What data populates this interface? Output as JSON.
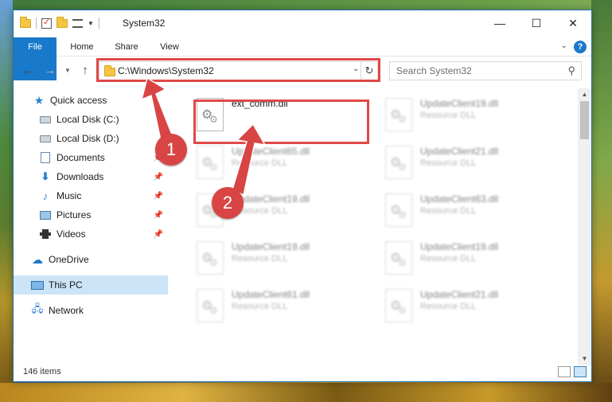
{
  "window": {
    "title": "System32"
  },
  "ribbon": {
    "tabs": [
      "File",
      "Home",
      "Share",
      "View"
    ]
  },
  "address": {
    "path": "C:\\Windows\\System32"
  },
  "search": {
    "placeholder": "Search System32"
  },
  "nav": {
    "items": [
      {
        "label": "Quick access",
        "icon": "star-icon"
      },
      {
        "label": "Local Disk (C:)",
        "icon": "drive-icon"
      },
      {
        "label": "Local Disk (D:)",
        "icon": "drive-icon"
      },
      {
        "label": "Documents",
        "icon": "documents-icon",
        "pinned": true
      },
      {
        "label": "Downloads",
        "icon": "downloads-icon",
        "pinned": true
      },
      {
        "label": "Music",
        "icon": "music-icon",
        "pinned": true
      },
      {
        "label": "Pictures",
        "icon": "pictures-icon",
        "pinned": true
      },
      {
        "label": "Videos",
        "icon": "videos-icon",
        "pinned": true
      },
      {
        "label": "OneDrive",
        "icon": "cloud-icon"
      },
      {
        "label": "This PC",
        "icon": "computer-icon",
        "selected": true
      },
      {
        "label": "Network",
        "icon": "network-icon"
      }
    ]
  },
  "files": [
    {
      "name": "ext_comm.dll",
      "type": ""
    },
    {
      "name": "UpdateClient19.dll",
      "type": "Resource DLL"
    },
    {
      "name": "UpdateClient65.dll",
      "type": "Resource DLL"
    },
    {
      "name": "UpdateClient21.dll",
      "type": "Resource DLL"
    },
    {
      "name": "UpdateClient19.dll",
      "type": "Resource DLL"
    },
    {
      "name": "UpdateClient63.dll",
      "type": "Resource DLL"
    },
    {
      "name": "UpdateClient19.dll",
      "type": "Resource DLL"
    },
    {
      "name": "UpdateClient19.dll",
      "type": "Resource DLL"
    },
    {
      "name": "UpdateClient61.dll",
      "type": "Resource DLL"
    },
    {
      "name": "UpdateClient21.dll",
      "type": "Resource DLL"
    }
  ],
  "status": {
    "item_count": "146 items"
  },
  "annotations": {
    "step1": "1",
    "step2": "2"
  },
  "colors": {
    "accent": "#1979ca",
    "highlight": "#e04848",
    "selected": "#cce4f7"
  }
}
